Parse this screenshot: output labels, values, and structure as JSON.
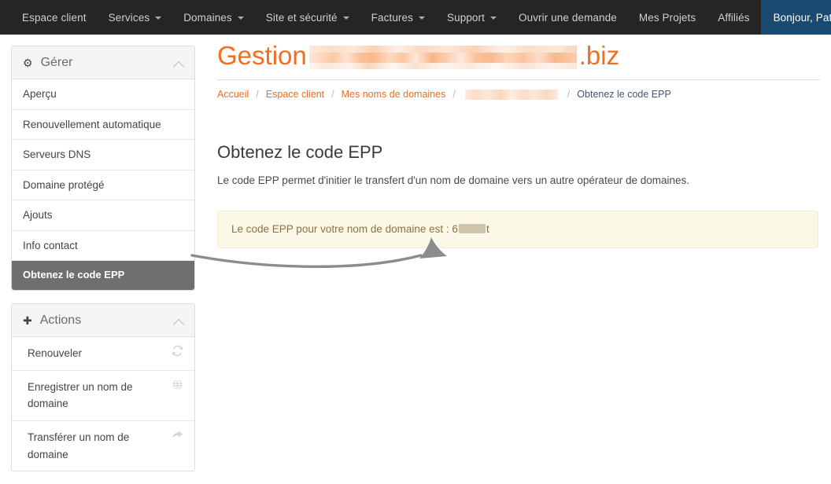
{
  "topnav": {
    "items": [
      {
        "label": "Espace client",
        "has_caret": false,
        "active": false
      },
      {
        "label": "Services",
        "has_caret": true,
        "active": false
      },
      {
        "label": "Domaines",
        "has_caret": true,
        "active": false
      },
      {
        "label": "Site et sécurité",
        "has_caret": true,
        "active": false
      },
      {
        "label": "Factures",
        "has_caret": true,
        "active": false
      },
      {
        "label": "Support",
        "has_caret": true,
        "active": false
      },
      {
        "label": "Ouvrir une demande",
        "has_caret": false,
        "active": false
      },
      {
        "label": "Mes Projets",
        "has_caret": false,
        "active": false
      },
      {
        "label": "Affiliés",
        "has_caret": false,
        "active": false
      },
      {
        "label": "Bonjour, Patrick!",
        "has_caret": true,
        "active": true
      }
    ],
    "background_color": "#252525",
    "active_color": "#1b4a71"
  },
  "sidebar": {
    "manage_panel": {
      "title": "Gérer",
      "icon": "gear-icon",
      "collapse_icon": "chevron-up-icon",
      "items": [
        {
          "label": "Aperçu",
          "selected": false
        },
        {
          "label": "Renouvellement automatique",
          "selected": false
        },
        {
          "label": "Serveurs DNS",
          "selected": false
        },
        {
          "label": "Domaine protégé",
          "selected": false
        },
        {
          "label": "Ajouts",
          "selected": false
        },
        {
          "label": "Info contact",
          "selected": false
        },
        {
          "label": "Obtenez le code EPP",
          "selected": true
        }
      ]
    },
    "actions_panel": {
      "title": "Actions",
      "icon": "plus-icon",
      "collapse_icon": "chevron-up-icon",
      "items": [
        {
          "label": "Renouveler",
          "icon": "refresh-icon"
        },
        {
          "label": "Enregistrer un nom de domaine",
          "icon": "globe-icon"
        },
        {
          "label": "Transférer un nom de domaine",
          "icon": "forward-arrow-icon"
        }
      ]
    }
  },
  "main": {
    "title_prefix": "Gestion",
    "title_domain_redacted": true,
    "title_suffix": ".biz",
    "title_color": "#f26d20",
    "breadcrumb": [
      {
        "label": "Accueil",
        "current": false,
        "redacted": false
      },
      {
        "label": "Espace client",
        "current": false,
        "redacted": false
      },
      {
        "label": "Mes noms de domaines",
        "current": false,
        "redacted": false
      },
      {
        "label": "",
        "current": false,
        "redacted": true
      },
      {
        "label": "Obtenez le code EPP",
        "current": true,
        "redacted": false
      }
    ],
    "breadcrumb_separator": "/",
    "section_title": "Obtenez le code EPP",
    "section_description": "Le code EPP permet d'initier le transfert d'un nom de domaine vers un autre opérateur de domaines.",
    "alert": {
      "text_before": "Le code EPP pour votre nom de domaine est : 6",
      "text_after": "t",
      "code_redacted": true,
      "background_color": "#fcf8e8",
      "border_color": "#f3ecd4",
      "text_color": "#8a7340"
    }
  },
  "annotation": {
    "type": "curved-arrow",
    "color": "#8c8c8c",
    "points_from": "sidebar-item-obtenez-le-code-epp",
    "points_to": "epp-code-value"
  }
}
